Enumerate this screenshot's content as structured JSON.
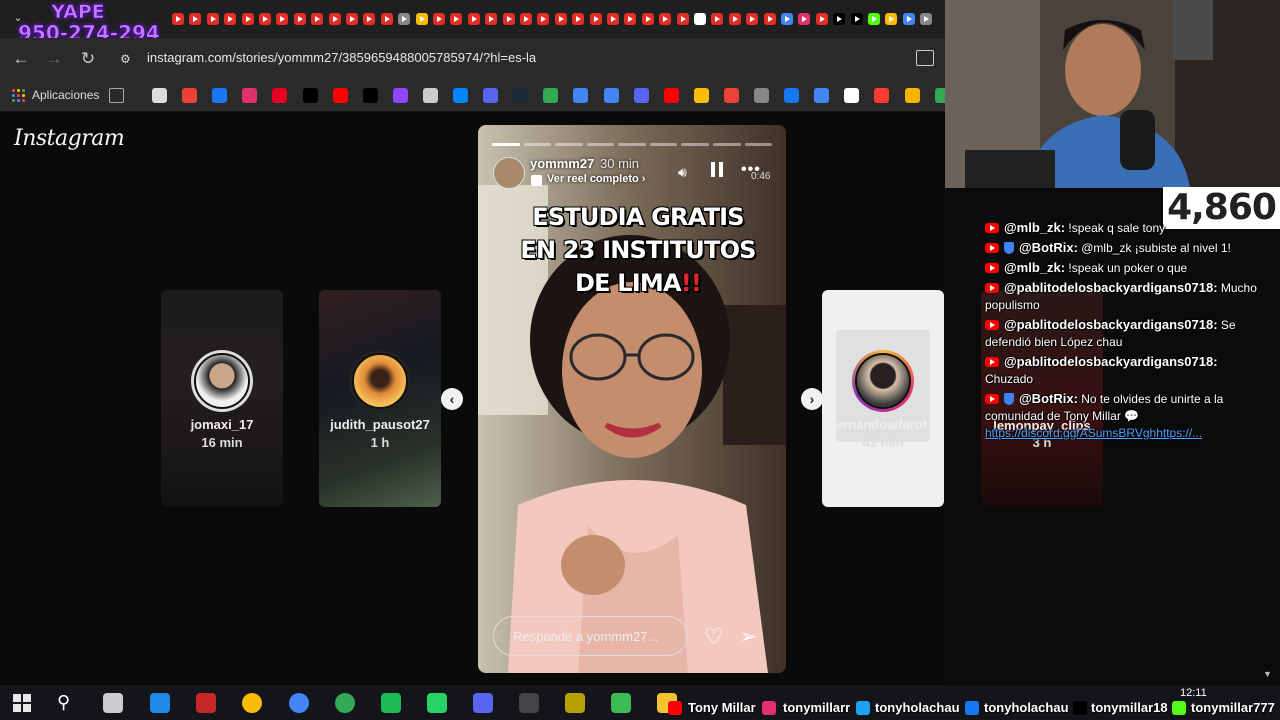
{
  "browser": {
    "url": "instagram.com/stories/yommm27/385965948800578597​4/?hl=es-la",
    "bookmarks_apps_label": "Aplicaciones"
  },
  "overlay": {
    "yape_label": "YAPE",
    "yape_number": "950-274-294",
    "viewer_count": "4,860"
  },
  "instagram": {
    "logo": "Instagram",
    "side_stories": [
      {
        "name": "jomaxi_17",
        "time": "16 min"
      },
      {
        "name": "judith_pausot27",
        "time": "1 h"
      },
      {
        "name": "fernandoalfarot_",
        "time": "41 min"
      },
      {
        "name": "lemonpay_clips",
        "time": "3 h"
      }
    ],
    "story": {
      "user": "yommm27",
      "time": "30 min",
      "reel_link": "Ver reel completo",
      "duration": "0:46",
      "headline_1": "ESTUDIA GRATIS",
      "headline_2": "EN 23 INSTITUTOS",
      "headline_3": "DE LIMA",
      "headline_marks": "!!",
      "reply_placeholder": "Responde a yommm27...",
      "progress_total": 9,
      "progress_done": 1
    }
  },
  "chat": {
    "messages": [
      {
        "user": "@mlb_zk:",
        "text": "!speak q sale tony",
        "badge": "yt"
      },
      {
        "user": "@BotRix:",
        "text": "@mlb_zk ¡subiste al nivel 1!",
        "badge": "yt-shield"
      },
      {
        "user": "@mlb_zk:",
        "text": "!speak un poker o que",
        "badge": "yt"
      },
      {
        "user": "@pablitodelosbackyardigans0718:",
        "text": "Mucho populismo",
        "badge": "yt"
      },
      {
        "user": "@pablitodelosbackyardigans0718:",
        "text": "Se defendió bien López chau",
        "badge": "yt"
      },
      {
        "user": "@pablitodelosbackyardigans0718:",
        "text": "Chuzado",
        "badge": "yt"
      },
      {
        "user": "@BotRix:",
        "text": "No te olvides de unirte a la comunidad de Tony Millar 💬",
        "badge": "yt-shield"
      }
    ],
    "link": "https://discord.gg/ASumsBRVghhttps://..."
  },
  "taskbar": {
    "socials": [
      "Tony Millar",
      "tonymillarr",
      "tonyholachau",
      "tonyholachau",
      "tonymillar18",
      "tonymillar777"
    ],
    "clock": "12:11"
  },
  "colors": {
    "instagram_bg": "#0a0a0a",
    "youtube_red": "#ff0000",
    "yape_purple": "#c07cff",
    "link_blue": "#4aa3ff"
  }
}
